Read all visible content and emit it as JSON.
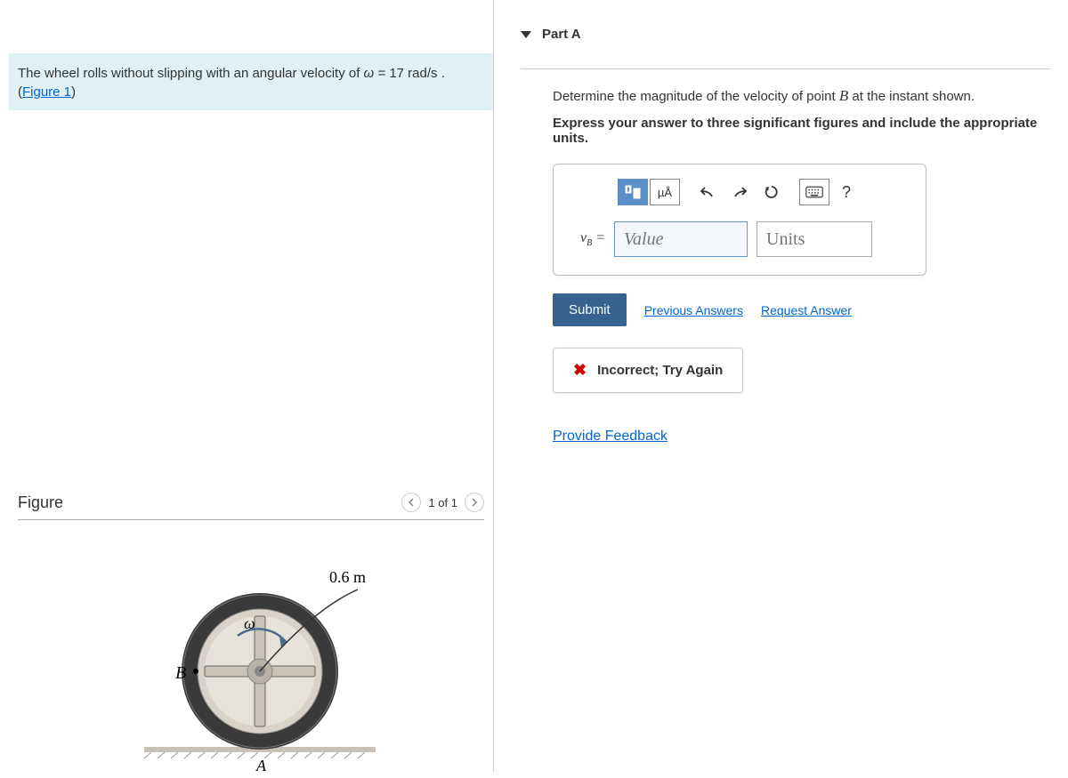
{
  "problem": {
    "text_before": "The wheel rolls without slipping with an angular velocity of ",
    "omega_sym": "ω =",
    "omega_val": "17 rad/s",
    "period": " . (",
    "figure_link": "Figure 1",
    "close": ")"
  },
  "figure": {
    "title": "Figure",
    "pager": "1 of 1",
    "radius_label": "0.6 m",
    "point_B": "B",
    "point_A": "A",
    "omega": "ω"
  },
  "part": {
    "title": "Part A",
    "instruction_pre": "Determine the magnitude of the velocity of point ",
    "instruction_var": "B",
    "instruction_post": " at the instant shown.",
    "sub_instruction": "Express your answer to three significant figures and include the appropriate units.",
    "toolbar": {
      "mu_a": "µÅ",
      "help": "?"
    },
    "var_label_v": "v",
    "var_label_sub": "B",
    "equals": " =",
    "value_placeholder": "Value",
    "units_placeholder": "Units",
    "submit": "Submit",
    "prev_answers": "Previous Answers",
    "request_answer": "Request Answer",
    "feedback": "Incorrect; Try Again"
  },
  "footer": {
    "provide_feedback": "Provide Feedback"
  }
}
